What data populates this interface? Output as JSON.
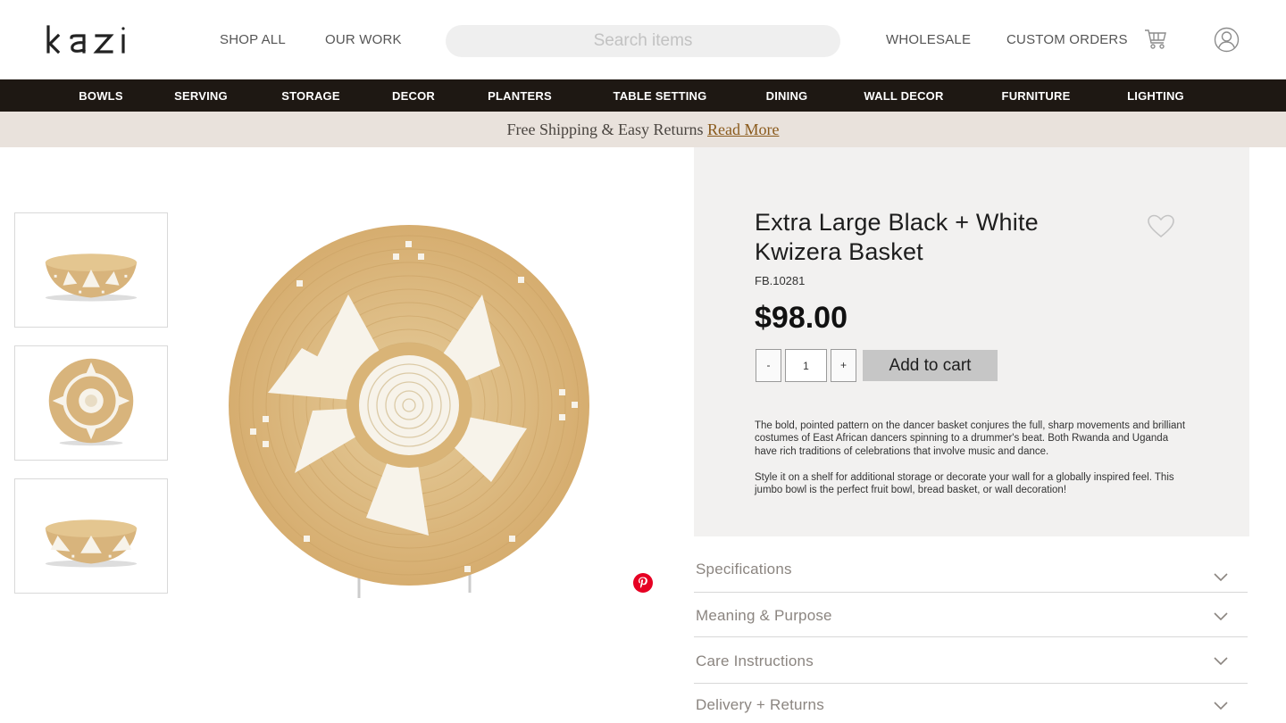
{
  "header": {
    "logo_text": "kazi",
    "nav": [
      {
        "label": "SHOP ALL"
      },
      {
        "label": "OUR WORK"
      },
      {
        "label": "WHOLESALE"
      },
      {
        "label": "CUSTOM ORDERS"
      }
    ],
    "search_placeholder": "Search items",
    "cart_icon": "cart-icon",
    "account_icon": "user-icon"
  },
  "categories": [
    "BOWLS",
    "SERVING",
    "STORAGE",
    "DECOR",
    "PLANTERS",
    "TABLE SETTING",
    "DINING",
    "WALL DECOR",
    "FURNITURE",
    "LIGHTING"
  ],
  "promo": {
    "text": "Free Shipping & Easy Returns ",
    "link": "Read More"
  },
  "product": {
    "title": "Extra Large Black + White Kwizera  Basket",
    "sku": "FB.10281",
    "price": "$98.00",
    "quantity": "1",
    "minus_label": "-",
    "plus_label": "+",
    "add_to_cart": "Add to cart",
    "description_1": "The bold, pointed pattern on the dancer basket conjures the full, sharp movements and brilliant costumes of East African dancers spinning to a drummer's beat. Both Rwanda and Uganda have rich traditions of celebrations that involve music and dance.",
    "description_2": "Style it on a shelf for additional storage or decorate your wall for a globally inspired feel. This jumbo bowl is the perfect fruit bowl, bread basket, or wall decoration!"
  },
  "accordion": [
    {
      "label": "Specifications"
    },
    {
      "label": "Meaning & Purpose"
    },
    {
      "label": "Care Instructions"
    },
    {
      "label": "Delivery + Returns"
    }
  ],
  "colors": {
    "category_bar": "#1e1813",
    "promo_bg": "#e9e2dc",
    "promo_link": "#8a5a1c",
    "panel_bg": "#f2f1f0",
    "basket_tan": "#d8b47c",
    "basket_white": "#f7f3ea",
    "pinterest": "#e60023"
  }
}
